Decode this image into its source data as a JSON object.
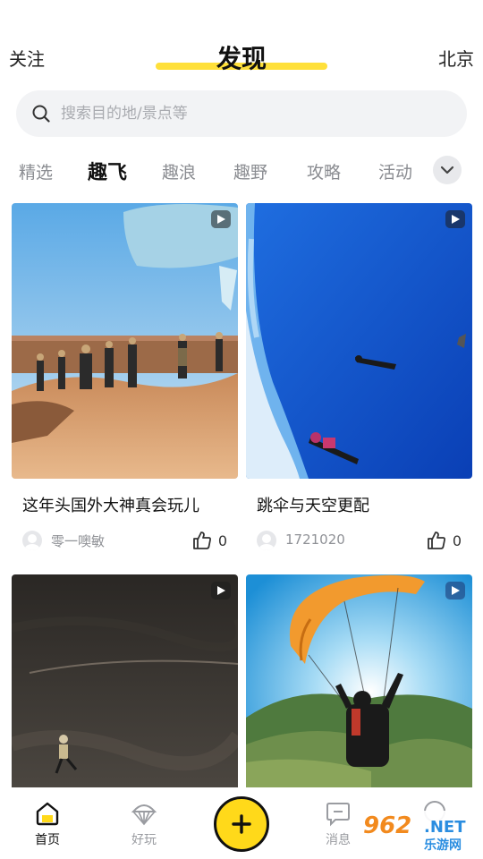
{
  "header": {
    "left_label": "关注",
    "title": "发现",
    "right_label": "北京"
  },
  "search": {
    "placeholder": "搜索目的地/景点等"
  },
  "tabs": [
    {
      "label": "精选",
      "active": false
    },
    {
      "label": "趣飞",
      "active": true
    },
    {
      "label": "趣浪",
      "active": false
    },
    {
      "label": "趣野",
      "active": false
    },
    {
      "label": "攻略",
      "active": false
    },
    {
      "label": "活动",
      "active": false
    }
  ],
  "cards": [
    {
      "title": "这年头国外大神真会玩儿",
      "author": "零一噢敏",
      "likes": "0",
      "icon": "play-icon"
    },
    {
      "title": "跳伞与天空更配",
      "author": "1721020",
      "likes": "0",
      "icon": "play-icon"
    },
    {
      "title": "",
      "author": "",
      "likes": "",
      "icon": "play-icon"
    },
    {
      "title": "",
      "author": "",
      "likes": "",
      "icon": "play-icon"
    }
  ],
  "bottom_nav": {
    "home": "首页",
    "fun": "好玩",
    "messages": "消息"
  },
  "watermark": {
    "brand": "962",
    "suffix": ".NET",
    "site": "乐游网"
  },
  "colors": {
    "accent": "#ffd91a",
    "underline": "#ffe03a"
  }
}
